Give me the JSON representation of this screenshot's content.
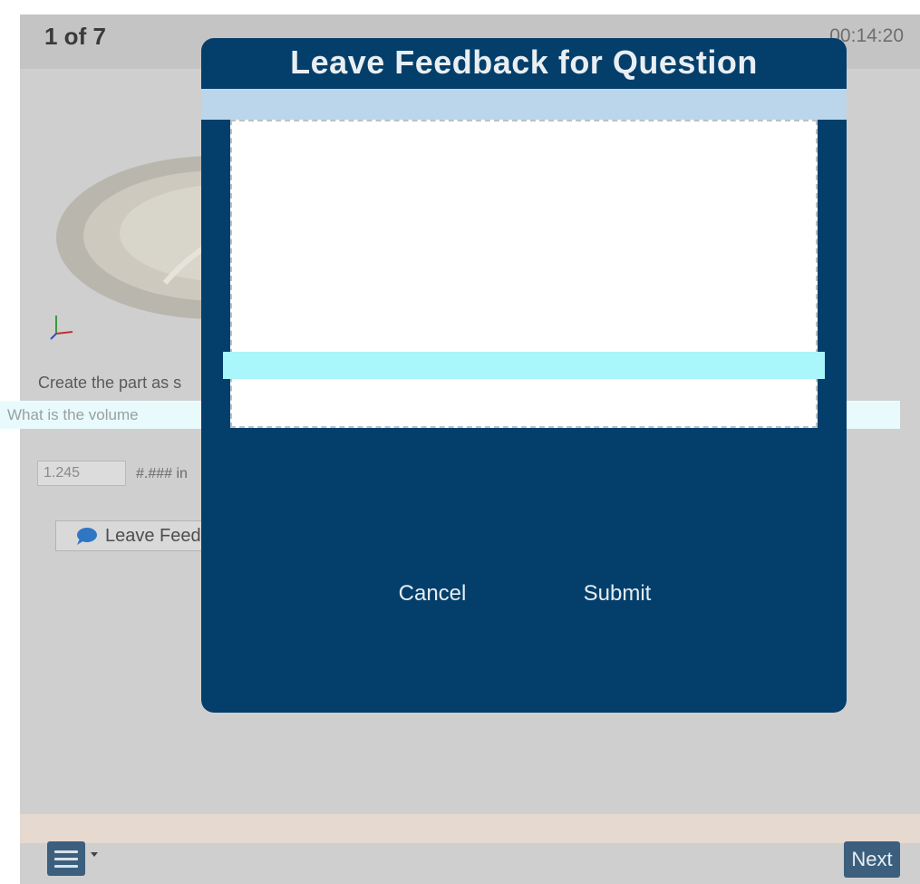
{
  "header": {
    "question_counter": "1 of 7",
    "timer": "00:14:20"
  },
  "question": {
    "instruction": "Create the part as s",
    "volume_prompt": "What is the volume",
    "answer_value": "1.245",
    "format_hint": "#.### in"
  },
  "feedback_button": {
    "label": "Leave Feed"
  },
  "modal": {
    "title": "Leave Feedback for Question",
    "textarea_value": "",
    "cancel_label": "Cancel",
    "submit_label": "Submit"
  },
  "footer": {
    "next_label": "Next"
  },
  "colors": {
    "modal_bg": "#043f6b",
    "page_overlay": "#cfcfcf",
    "button_bg": "#3c5f7e",
    "chat_icon": "#2f76c4"
  },
  "icons": {
    "menu": "hamburger-menu-icon",
    "chat": "chat-bubble-icon",
    "caret": "caret-down-icon"
  }
}
